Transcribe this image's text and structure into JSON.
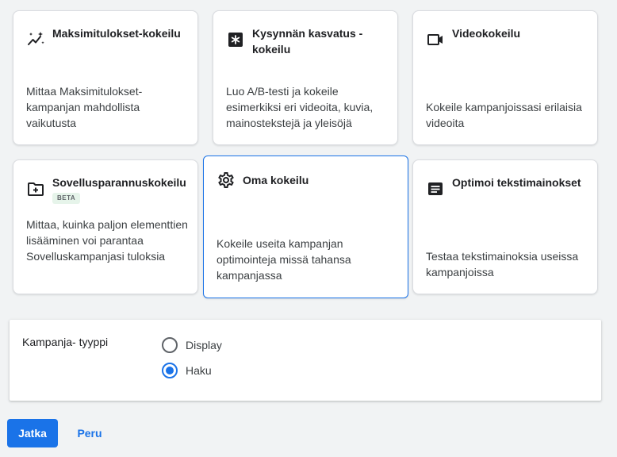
{
  "cards": [
    {
      "id": "maximize",
      "icon": "sparkle-trend-icon",
      "title": "Maksimitulokset-kokeilu",
      "description": "Mittaa Maksimitulokset-kampanjan mahdollista vaikutusta"
    },
    {
      "id": "demand",
      "icon": "asterisk-box-icon",
      "title": "Kysynnän kasvatus -kokeilu",
      "description": "Luo A/B-testi ja kokeile esimerkiksi eri videoita, kuvia, mainostekstejä ja yleisöjä"
    },
    {
      "id": "video",
      "icon": "video-camera-icon",
      "title": "Videokokeilu",
      "description": "Kokeile kampanjoissasi erilaisia videoita"
    },
    {
      "id": "app",
      "icon": "folder-plus-icon",
      "title": "Sovellusparannuskokeilu",
      "badge": "BETA",
      "description": "Mittaa, kuinka paljon elementtien lisääminen voi parantaa Sovelluskampanjasi tuloksia"
    },
    {
      "id": "custom",
      "icon": "gear-icon",
      "title": "Oma kokeilu",
      "description": "Kokeile useita kampanjan optimointeja missä tahansa kampanjassa",
      "selected": true
    },
    {
      "id": "text",
      "icon": "text-ad-icon",
      "title": "Optimoi tekstimainokset",
      "description": "Testaa tekstimainoksia useissa kampanjoissa"
    }
  ],
  "campaign_type": {
    "label": "Kampanja- tyyppi",
    "options": [
      {
        "label": "Display",
        "checked": false
      },
      {
        "label": "Haku",
        "checked": true
      }
    ]
  },
  "actions": {
    "continue_label": "Jatka",
    "cancel_label": "Peru"
  },
  "colors": {
    "accent": "#1a73e8",
    "background": "#f1f3f4",
    "badge_bg": "#e6f4ea"
  }
}
